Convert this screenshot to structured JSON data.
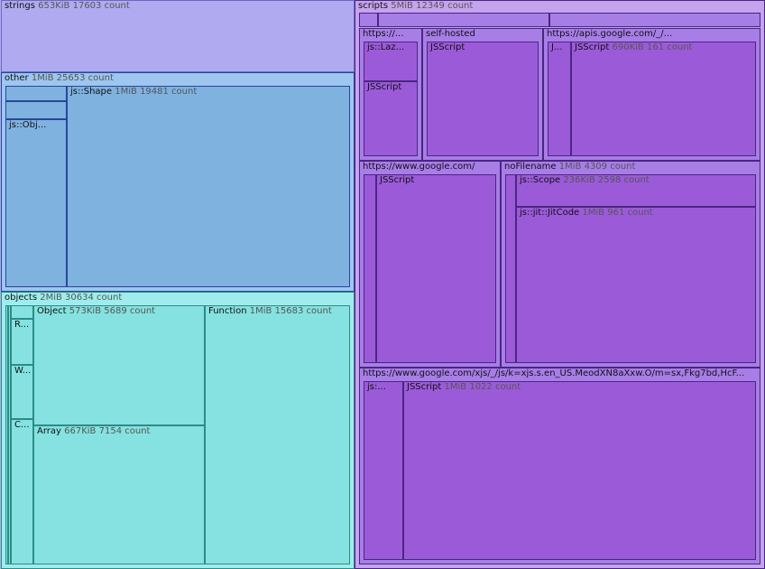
{
  "strings": {
    "name": "strings",
    "size": "653KiB",
    "count": "17603 count"
  },
  "other": {
    "name": "other",
    "size": "1MiB",
    "count": "25653 count",
    "children": {
      "shape": {
        "name": "js::Shape",
        "size": "1MiB",
        "count": "19481 count"
      },
      "obj": {
        "name": "js::Obj..."
      }
    }
  },
  "objects": {
    "name": "objects",
    "size": "2MiB",
    "count": "30634 count",
    "children": {
      "r": {
        "name": "R..."
      },
      "w": {
        "name": "W..."
      },
      "c": {
        "name": "C..."
      },
      "object": {
        "name": "Object",
        "size": "573KiB",
        "count": "5689 count"
      },
      "array": {
        "name": "Array",
        "size": "667KiB",
        "count": "7154 count"
      },
      "function": {
        "name": "Function",
        "size": "1MiB",
        "count": "15683 count"
      }
    }
  },
  "scripts": {
    "name": "scripts",
    "size": "5MiB",
    "count": "12349 count",
    "children": {
      "https_short": {
        "name": "https://...",
        "inner_a": "js::Laz...",
        "inner_b": "JSScript"
      },
      "self_hosted": {
        "name": "self-hosted",
        "inner": "JSScript"
      },
      "apis": {
        "name": "https://apis.google.com/_/...",
        "inner_a": "J...",
        "inner_b": "JSScript",
        "inner_b_size": "690KiB",
        "inner_b_count": "161 count"
      },
      "google": {
        "name": "https://www.google.com/",
        "inner": "JSScript"
      },
      "nofilename": {
        "name": "noFilename",
        "size": "1MiB",
        "count": "4309 count",
        "scope": {
          "name": "js::Scope",
          "size": "236KiB",
          "count": "2598 count"
        },
        "jitcode": {
          "name": "js::jit::JitCode",
          "size": "1MiB",
          "count": "961 count"
        }
      },
      "xjs": {
        "name": "https://www.google.com/xjs/_/js/k=xjs.s.en_US.MeodXN8aXxw.O/m=sx,Fkg7bd,HcF...",
        "inner_a": "js:...",
        "inner_b": "JSScript",
        "inner_b_size": "1MiB",
        "inner_b_count": "1022 count"
      }
    }
  }
}
